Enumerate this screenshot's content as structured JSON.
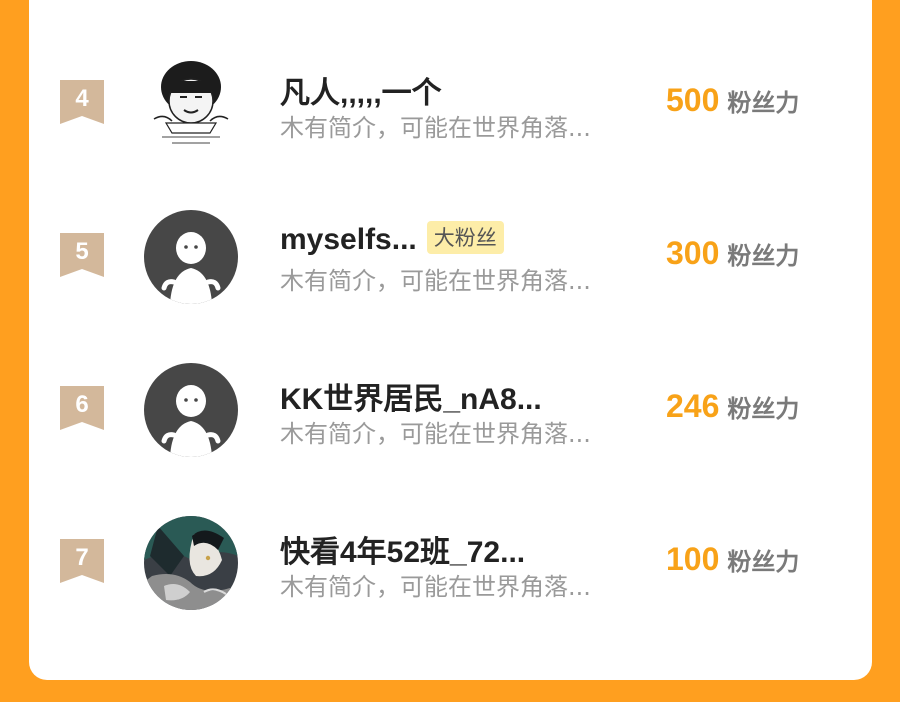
{
  "leaderboard": {
    "score_unit": "粉丝力",
    "entries": [
      {
        "rank": "4",
        "name": "凡人,,,,,一个",
        "tag": "",
        "bio": "木有简介，可能在世界角落...",
        "score": "500",
        "avatar": "meme-avatar"
      },
      {
        "rank": "5",
        "name": "myselfs...",
        "tag": "大粉丝",
        "bio": "木有简介，可能在世界角落...",
        "score": "300",
        "avatar": "default-avatar"
      },
      {
        "rank": "6",
        "name": "KK世界居民_nA8...",
        "tag": "",
        "bio": "木有简介，可能在世界角落...",
        "score": "246",
        "avatar": "default-avatar"
      },
      {
        "rank": "7",
        "name": "快看4年52班_72...",
        "tag": "",
        "bio": "木有简介，可能在世界角落...",
        "score": "100",
        "avatar": "anime-avatar"
      }
    ]
  },
  "colors": {
    "background": "#FF9F1F",
    "card": "#FFFFFF",
    "rank_badge": "#D3B89B",
    "score": "#F8A218",
    "tag_bg": "#FDEDA8",
    "name": "#222222",
    "bio": "#9A9A9A"
  }
}
